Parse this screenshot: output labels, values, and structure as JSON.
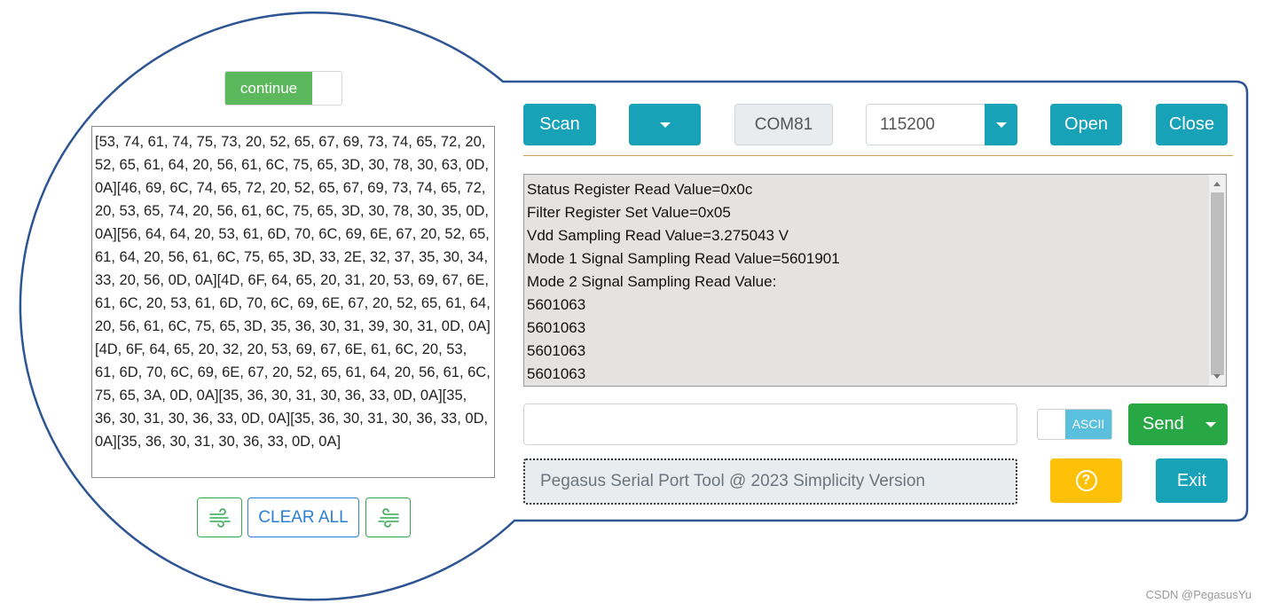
{
  "toggle_continue": {
    "label": "continue",
    "state": "on"
  },
  "hex_output": "[53, 74, 61, 74, 75, 73, 20, 52, 65, 67, 69, 73, 74, 65, 72, 20, 52, 65, 61, 64, 20, 56, 61, 6C, 75, 65, 3D, 30, 78, 30, 63, 0D, 0A][46, 69, 6C, 74, 65, 72, 20, 52, 65, 67, 69, 73, 74, 65, 72, 20, 53, 65, 74, 20, 56, 61, 6C, 75, 65, 3D, 30, 78, 30, 35, 0D, 0A][56, 64, 64, 20, 53, 61, 6D, 70, 6C, 69, 6E, 67, 20, 52, 65, 61, 64, 20, 56, 61, 6C, 75, 65, 3D, 33, 2E, 32, 37, 35, 30, 34, 33, 20, 56, 0D, 0A][4D, 6F, 64, 65, 20, 31, 20, 53, 69, 67, 6E, 61, 6C, 20, 53, 61, 6D, 70, 6C, 69, 6E, 67, 20, 52, 65, 61, 64, 20, 56, 61, 6C, 75, 65, 3D, 35, 36, 30, 31, 39, 30, 31, 0D, 0A][4D, 6F, 64, 65, 20, 32, 20, 53, 69, 67, 6E, 61, 6C, 20, 53, 61, 6D, 70, 6C, 69, 6E, 67, 20, 52, 65, 61, 64, 20, 56, 61, 6C, 75, 65, 3A, 0D, 0A][35, 36, 30, 31, 30, 36, 33, 0D, 0A][35, 36, 30, 31, 30, 36, 33, 0D, 0A][35, 36, 30, 31, 30, 36, 33, 0D, 0A][35, 36, 30, 31, 30, 36, 33, 0D, 0A]",
  "left_buttons": {
    "clear_all": "CLEAR ALL",
    "left_icon": "wind-left-icon",
    "right_icon": "wind-right-icon"
  },
  "toolbar": {
    "scan": "Scan",
    "port": "COM81",
    "baud": "115200",
    "open": "Open",
    "close": "Close"
  },
  "log_lines": [
    "Status Register Read Value=0x0c",
    "Filter Register Set Value=0x05",
    "Vdd Sampling Read Value=3.275043 V",
    "Mode 1 Signal Sampling Read Value=5601901",
    "Mode 2 Signal Sampling Read Value:",
    "5601063",
    "5601063",
    "5601063",
    "5601063"
  ],
  "send_row": {
    "input_value": "",
    "mode_label": "ASCII",
    "send": "Send"
  },
  "status_text": "Pegasus Serial Port Tool @ 2023 Simplicity Version",
  "help_icon": "question-circle-icon",
  "exit": "Exit",
  "watermark": "CSDN @PegasusYu",
  "colors": {
    "teal": "#17a2b8",
    "green": "#28a745",
    "yellow": "#ffc107",
    "outline_blue": "#2d5594"
  }
}
